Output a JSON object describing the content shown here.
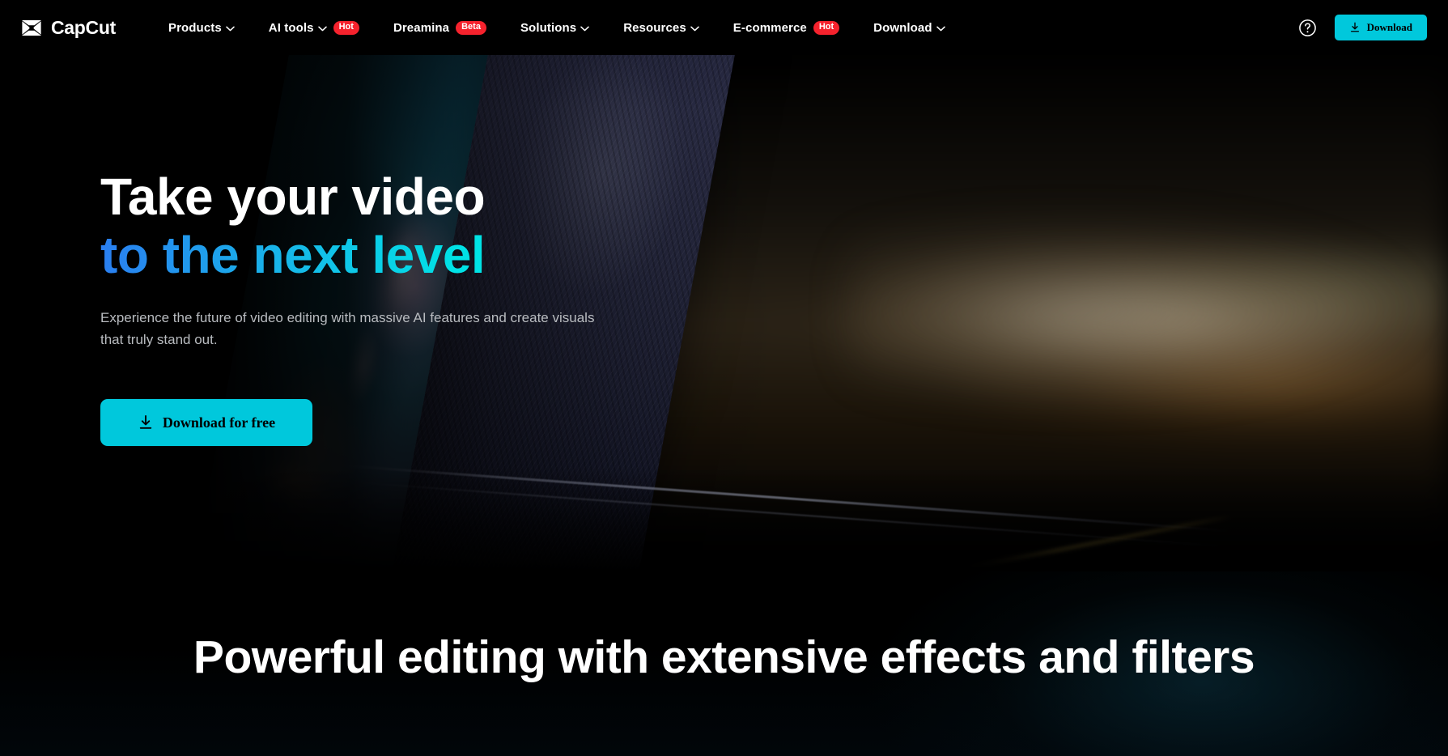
{
  "header": {
    "logo": {
      "icon": "capcut-logo-icon",
      "text": "CapCut"
    },
    "nav": [
      {
        "label": "Products",
        "caret": true,
        "badge": null
      },
      {
        "label": "AI tools",
        "caret": true,
        "badge": "Hot"
      },
      {
        "label": "Dreamina",
        "caret": false,
        "badge": "Beta"
      },
      {
        "label": "Solutions",
        "caret": true,
        "badge": null
      },
      {
        "label": "Resources",
        "caret": true,
        "badge": null
      },
      {
        "label": "E-commerce",
        "caret": false,
        "badge": "Hot"
      },
      {
        "label": "Download",
        "caret": true,
        "badge": null
      }
    ],
    "help_icon": "help-circle-icon",
    "download_button": {
      "label": "Download",
      "icon": "download-icon"
    }
  },
  "hero": {
    "heading_line1": "Take your video",
    "heading_line2": "to the next level",
    "subheading": "Experience the future of video editing with massive AI features and create visuals that truly stand out.",
    "cta": {
      "label": "Download for free",
      "icon": "download-icon"
    }
  },
  "section2": {
    "heading": "Powerful editing with extensive effects and filters"
  },
  "colors": {
    "accent_cyan": "#00c8dc",
    "badge_red": "#f5222d",
    "gradient_start": "#2a7ef0",
    "gradient_end": "#00e8e0",
    "background": "#000000",
    "body_text": "#b9bcc0"
  }
}
